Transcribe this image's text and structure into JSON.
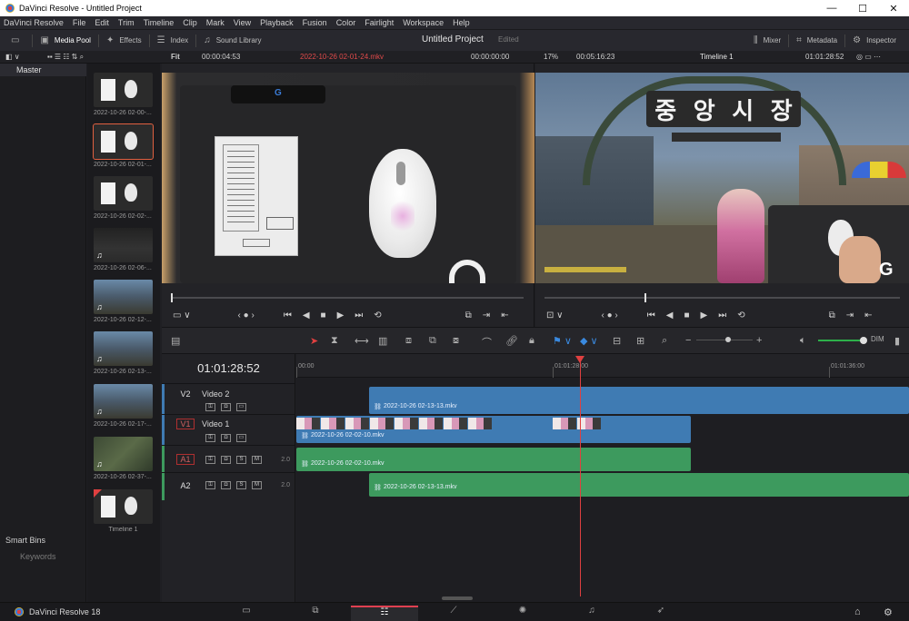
{
  "window": {
    "title": "DaVinci Resolve - Untitled Project",
    "minimize": "—",
    "maximize": "☐",
    "close": "✕"
  },
  "menu": [
    "DaVinci Resolve",
    "File",
    "Edit",
    "Trim",
    "Timeline",
    "Clip",
    "Mark",
    "View",
    "Playback",
    "Fusion",
    "Color",
    "Fairlight",
    "Workspace",
    "Help"
  ],
  "toolbar": {
    "media_pool": "Media Pool",
    "effects": "Effects",
    "index": "Index",
    "sound_library": "Sound Library",
    "project_title": "Untitled Project",
    "edited": "Edited",
    "mixer": "Mixer",
    "metadata": "Metadata",
    "inspector": "Inspector"
  },
  "source_viewer": {
    "zoom": "Fit",
    "duration": "00:00:04:53",
    "clip_name": "2022-10-26 02-01-24.mkv",
    "timecode": "00:00:00:00"
  },
  "timeline_viewer": {
    "zoom": "17%",
    "duration": "00:05:16:23",
    "timeline_name": "Timeline 1",
    "timecode": "01:01:28:52"
  },
  "bins": {
    "master": "Master",
    "smart_bins": "Smart Bins",
    "keywords": "Keywords"
  },
  "clips": [
    {
      "label": "2022-10-26 02-00-...",
      "kind": "mouse",
      "selected": false,
      "audio": false
    },
    {
      "label": "2022-10-26 02-01-...",
      "kind": "mouse",
      "selected": true,
      "audio": false
    },
    {
      "label": "2022-10-26 02-02-...",
      "kind": "mouse",
      "selected": false,
      "audio": false
    },
    {
      "label": "2022-10-26 02-06-...",
      "kind": "dark",
      "selected": false,
      "audio": true
    },
    {
      "label": "2022-10-26 02-12-...",
      "kind": "game",
      "selected": false,
      "audio": true
    },
    {
      "label": "2022-10-26 02-13-...",
      "kind": "game",
      "selected": false,
      "audio": true
    },
    {
      "label": "2022-10-26 02-17-...",
      "kind": "game",
      "selected": false,
      "audio": true
    },
    {
      "label": "2022-10-26 02-37-...",
      "kind": "map",
      "selected": false,
      "audio": true
    },
    {
      "label": "Timeline 1",
      "kind": "mouse",
      "selected": false,
      "audio": false
    }
  ],
  "sign_text": [
    "중",
    "앙",
    "시",
    "장"
  ],
  "timeline": {
    "current_tc": "01:01:28:52",
    "ruler": [
      "00:00",
      "01:01:28:00",
      "01:01:36:00"
    ],
    "tracks": {
      "v2": {
        "id": "V2",
        "name": "Video 2"
      },
      "v1": {
        "id": "V1",
        "name": "Video 1"
      },
      "a1": {
        "id": "A1",
        "level": "2.0"
      },
      "a2": {
        "id": "A2",
        "level": "2.0"
      }
    },
    "clip_names": {
      "v2": "2022-10-26 02-13-13.mkv",
      "v1": "2022-10-26 02-02-10.mkv",
      "a1": "2022-10-26 02-02-10.mkv",
      "a2": "2022-10-26 02-13-13.mkv"
    },
    "track_buttons": {
      "solo": "S",
      "mute": "M"
    }
  },
  "pagebar": {
    "brand": "DaVinci Resolve 18",
    "pages": [
      "media",
      "cut",
      "edit",
      "fusion",
      "color",
      "fairlight",
      "deliver"
    ],
    "active_page": "edit"
  },
  "colors": {
    "video_clip": "#3f7bb3",
    "audio_clip": "#3d9a5e",
    "playhead": "#e04040",
    "selected_clip": "#e06040"
  }
}
